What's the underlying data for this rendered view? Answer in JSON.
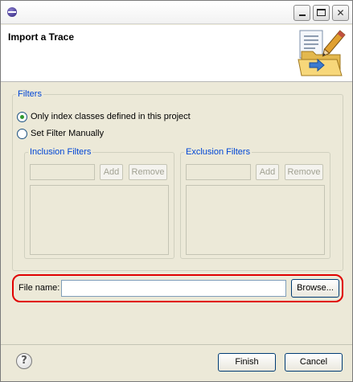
{
  "window": {
    "icons": {
      "app": "eclipse-icon",
      "minimize": "minimize-icon",
      "maximize": "maximize-icon",
      "close": "close-icon"
    },
    "close_glyph": "✕"
  },
  "banner": {
    "title": "Import a Trace",
    "illustration": "import-wizard-folder-pencil-icon"
  },
  "filters": {
    "legend": "Filters",
    "radio_options": [
      {
        "label": "Only index classes defined in this project",
        "selected": true
      },
      {
        "label": "Set Filter Manually",
        "selected": false
      }
    ],
    "inclusion": {
      "legend": "Inclusion Filters",
      "input_value": "",
      "add_label": "Add",
      "remove_label": "Remove"
    },
    "exclusion": {
      "legend": "Exclusion Filters",
      "input_value": "",
      "add_label": "Add",
      "remove_label": "Remove"
    }
  },
  "file": {
    "label": "File name:",
    "value": "",
    "browse_label": "Browse...",
    "highlight_color": "#e00000"
  },
  "footer": {
    "help_glyph": "?",
    "finish_label": "Finish",
    "cancel_label": "Cancel"
  },
  "colors": {
    "legend": "#0046d5",
    "dialog_bg": "#ece9d8",
    "disabled_text": "#a1a192"
  }
}
